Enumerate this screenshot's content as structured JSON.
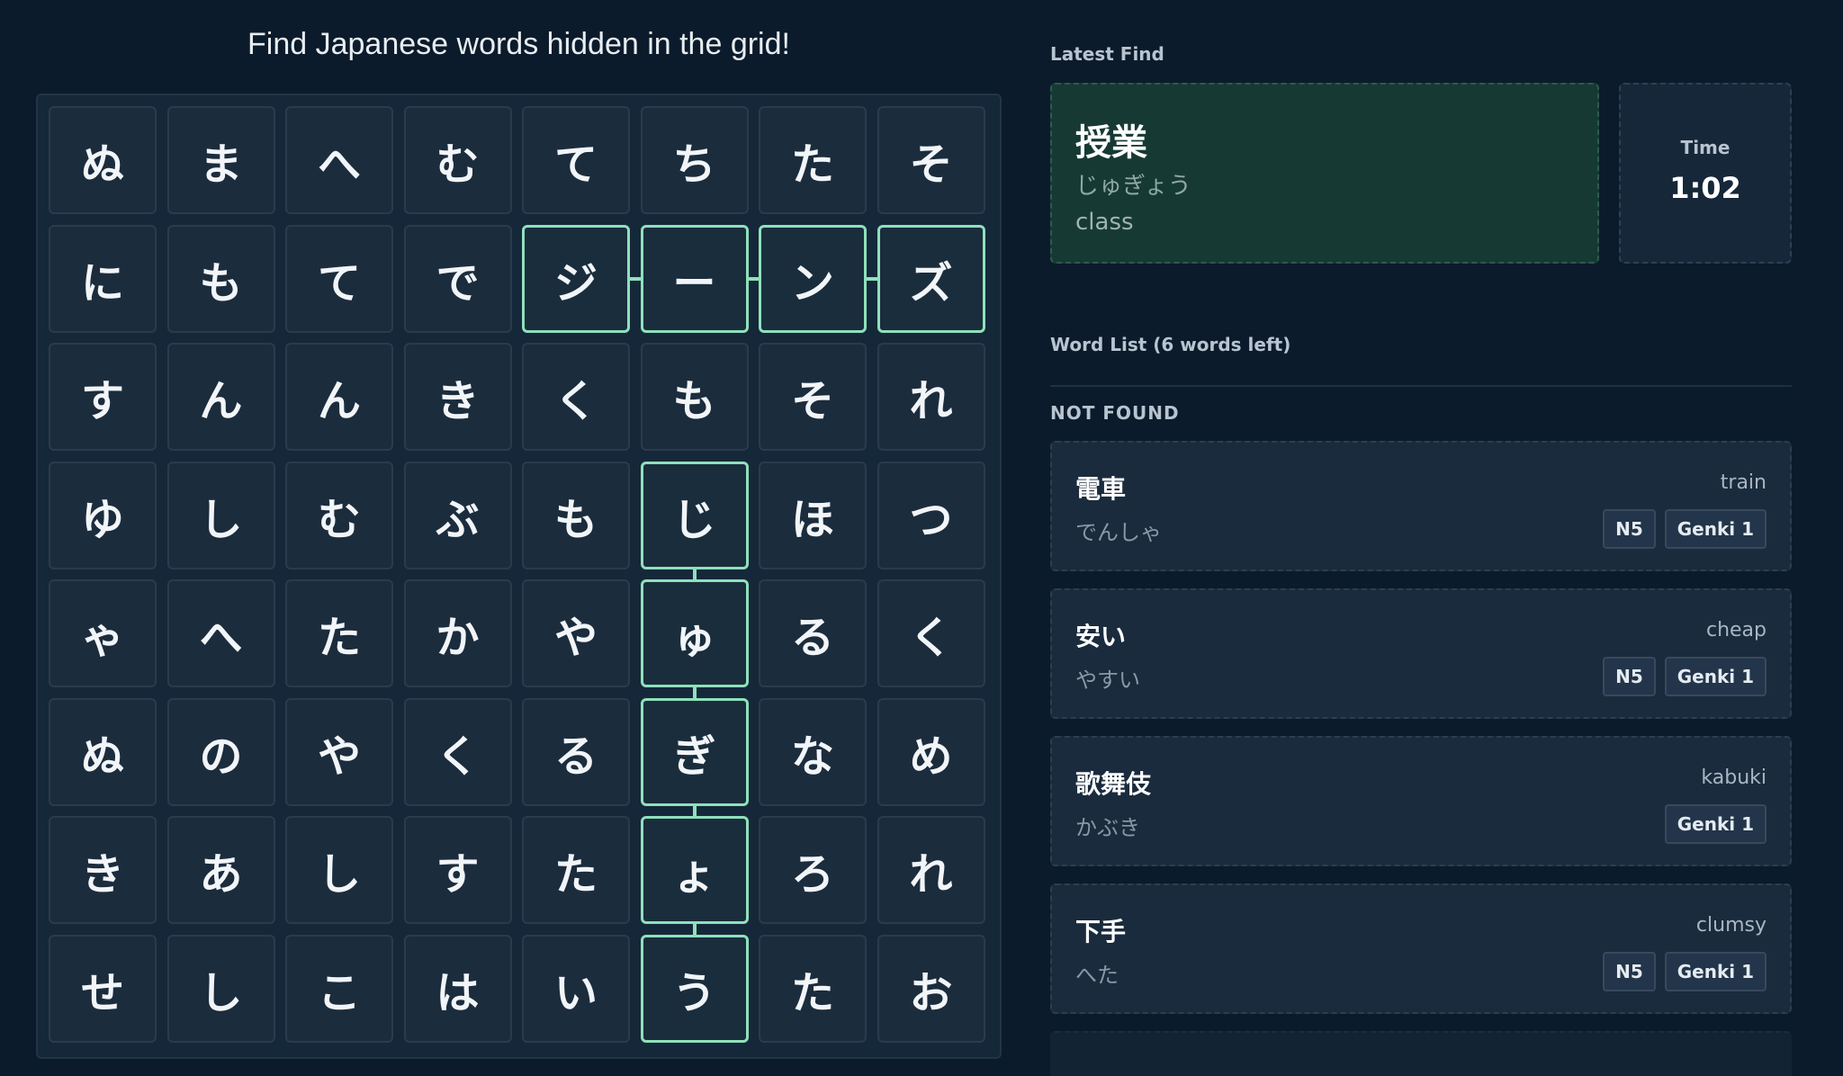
{
  "instructions": "Find Japanese words hidden in the grid!",
  "grid": [
    [
      "ぬ",
      "ま",
      "へ",
      "む",
      "て",
      "ち",
      "た",
      "そ"
    ],
    [
      "に",
      "も",
      "て",
      "で",
      "ジ",
      "ー",
      "ン",
      "ズ"
    ],
    [
      "す",
      "ん",
      "ん",
      "き",
      "く",
      "も",
      "そ",
      "れ"
    ],
    [
      "ゆ",
      "し",
      "む",
      "ぶ",
      "も",
      "じ",
      "ほ",
      "つ"
    ],
    [
      "ゃ",
      "へ",
      "た",
      "か",
      "や",
      "ゅ",
      "る",
      "く"
    ],
    [
      "ぬ",
      "の",
      "や",
      "く",
      "る",
      "ぎ",
      "な",
      "め"
    ],
    [
      "き",
      "あ",
      "し",
      "す",
      "た",
      "ょ",
      "ろ",
      "れ"
    ],
    [
      "せ",
      "し",
      "こ",
      "は",
      "い",
      "う",
      "た",
      "お"
    ]
  ],
  "found_paths": [
    [
      [
        1,
        4
      ],
      [
        1,
        5
      ],
      [
        1,
        6
      ],
      [
        1,
        7
      ]
    ],
    [
      [
        3,
        5
      ],
      [
        4,
        5
      ],
      [
        5,
        5
      ],
      [
        6,
        5
      ],
      [
        7,
        5
      ]
    ]
  ],
  "colors": {
    "highlight": "#8fe0bb",
    "latest_bg": "#163a33",
    "background": "#0b1b2b"
  },
  "latest": {
    "label": "Latest Find",
    "kanji": "授業",
    "kana": "じゅぎょう",
    "english": "class"
  },
  "timer": {
    "label": "Time",
    "value": "1:02"
  },
  "word_list": {
    "title": "Word List",
    "remaining": "(6 words left)",
    "section": "NOT FOUND",
    "words": [
      {
        "kanji": "電車",
        "kana": "でんしゃ",
        "english": "train",
        "tags": [
          "N5",
          "Genki 1"
        ]
      },
      {
        "kanji": "安い",
        "kana": "やすい",
        "english": "cheap",
        "tags": [
          "N5",
          "Genki 1"
        ]
      },
      {
        "kanji": "歌舞伎",
        "kana": "かぶき",
        "english": "kabuki",
        "tags": [
          "Genki 1"
        ]
      },
      {
        "kanji": "下手",
        "kana": "へた",
        "english": "clumsy",
        "tags": [
          "N5",
          "Genki 1"
        ]
      }
    ]
  }
}
